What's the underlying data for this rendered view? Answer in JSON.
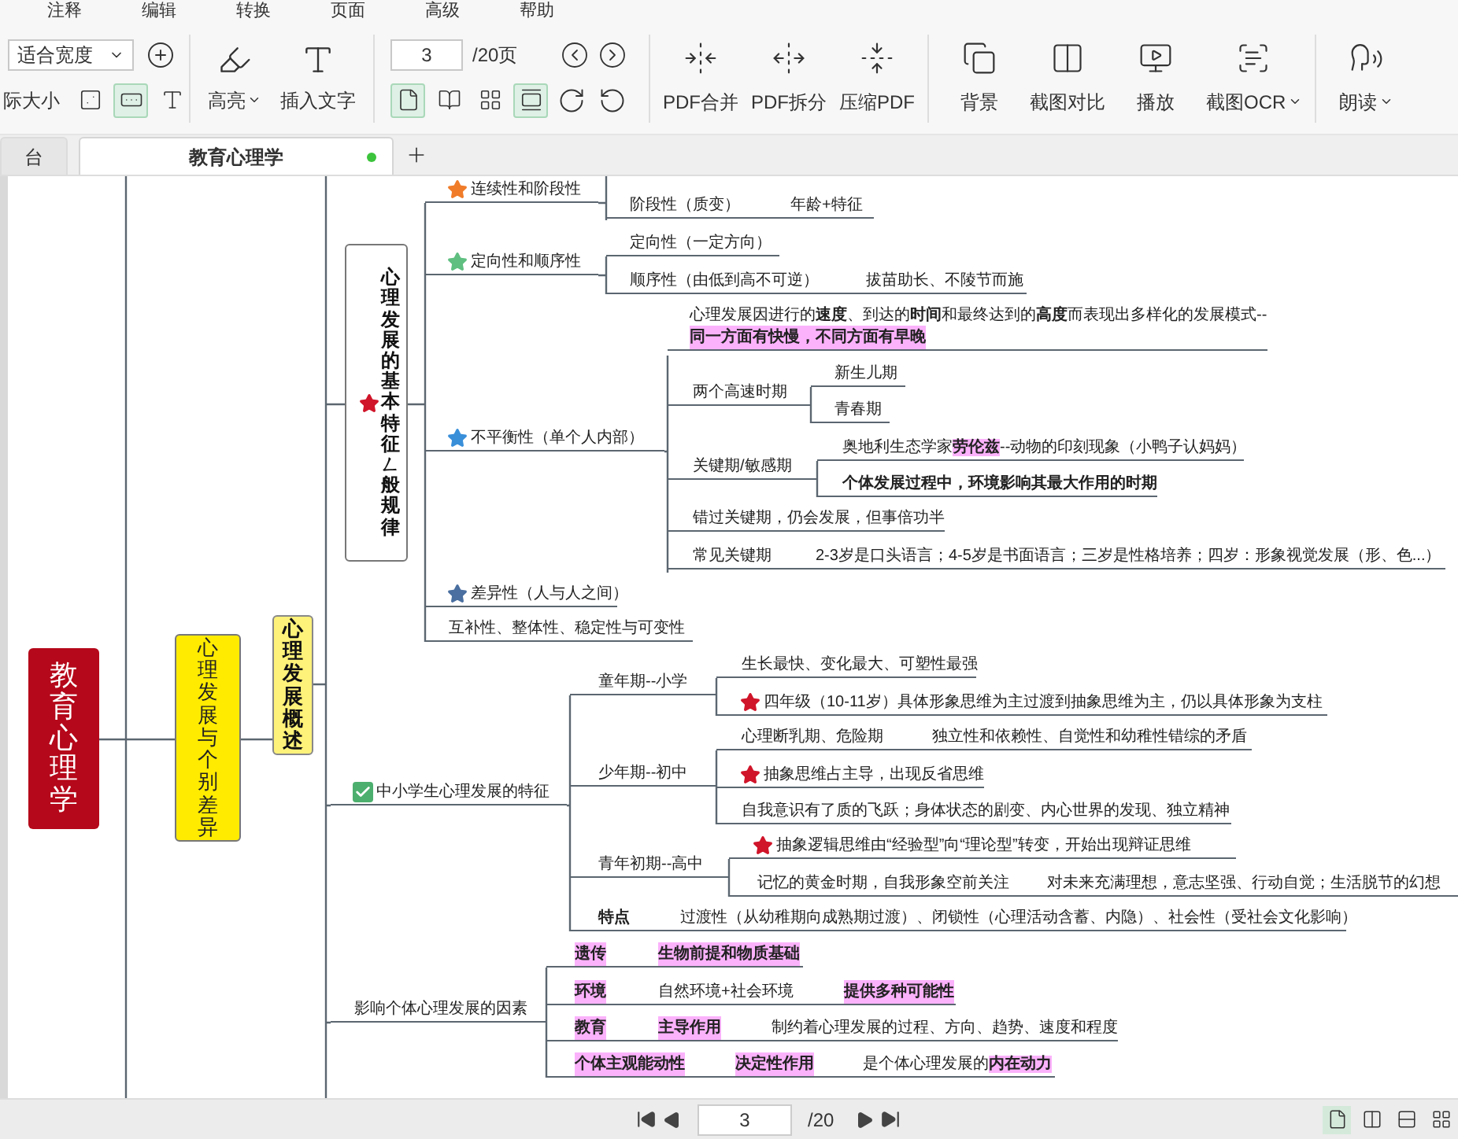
{
  "menu": [
    "注释",
    "编辑",
    "转换",
    "页面",
    "高级",
    "帮助"
  ],
  "toolbar": {
    "zoom": {
      "value": "适合宽度"
    },
    "actual_size": "际大小",
    "fit_modes": [
      {
        "kind": "page",
        "selected": false
      },
      {
        "kind": "width",
        "selected": true
      },
      {
        "kind": "text",
        "selected": false
      }
    ],
    "tools": [
      {
        "kind": "highlight",
        "label": "高亮",
        "dropdown": true
      },
      {
        "kind": "text",
        "label": "插入文字",
        "dropdown": false
      }
    ],
    "page": {
      "value": "3",
      "total": "/20页"
    },
    "view_modes": [
      {
        "kind": "single",
        "selected": true
      },
      {
        "kind": "double",
        "selected": false
      },
      {
        "kind": "grid",
        "selected": false
      },
      {
        "kind": "continuous",
        "selected": true
      }
    ],
    "actions": [
      {
        "kind": "merge",
        "label": "PDF合并",
        "dropdown": false
      },
      {
        "kind": "split",
        "label": "PDF拆分",
        "dropdown": false
      },
      {
        "kind": "compress",
        "label": "压缩PDF",
        "dropdown": false
      },
      {
        "kind": "background",
        "label": "背景",
        "dropdown": false
      },
      {
        "kind": "compare",
        "label": "截图对比",
        "dropdown": false
      },
      {
        "kind": "play",
        "label": "播放",
        "dropdown": false
      },
      {
        "kind": "ocr",
        "label": "截图OCR",
        "dropdown": true
      },
      {
        "kind": "read",
        "label": "朗读",
        "dropdown": true
      }
    ]
  },
  "tabs": [
    {
      "label": "台",
      "selected": false,
      "modified": false
    },
    {
      "label": "教育心理学",
      "selected": true,
      "modified": true
    }
  ],
  "mindmap": {
    "root": "教育心理学",
    "branch": "心理发展与个别差异",
    "subbranch": "心理发展概述",
    "feature_box": {
      "text": "心理发展的基本特征ㄥ般规律",
      "icon": {
        "kind": "star",
        "color": "#d0152a"
      }
    },
    "nodes": [
      {
        "icon": {
          "kind": "star",
          "color": "#f07c2a"
        },
        "segments": [
          {
            "text": "连续性和阶段性",
            "bold": false,
            "highlight": false
          }
        ]
      },
      {
        "segments": [
          {
            "text": "阶段性（质变）",
            "bold": false,
            "highlight": false
          },
          {
            "text": "年龄+特征",
            "bold": false,
            "highlight": false
          }
        ]
      },
      {
        "icon": {
          "kind": "star",
          "color": "#5fbf80"
        },
        "segments": [
          {
            "text": "定向性和顺序性",
            "bold": false,
            "highlight": false
          }
        ]
      },
      {
        "segments": [
          {
            "text": "定向性（一定方向）",
            "bold": false,
            "highlight": false
          }
        ]
      },
      {
        "segments": [
          {
            "text": "顺序性（由低到高不可逆）",
            "bold": false,
            "highlight": false
          },
          {
            "text": "拔苗助长、不陵节而施",
            "bold": false,
            "highlight": false
          }
        ]
      },
      {
        "segments": [
          {
            "text": "心理发展因进行的**速度**、到达的**时间**和最终达到的**高度**而表现出多样化的发展模式--",
            "bold": false,
            "highlight": false
          }
        ]
      },
      {
        "segments": [
          {
            "text": "同一方面有快慢，不同方面有早晚",
            "bold": true,
            "highlight": true
          }
        ]
      },
      {
        "icon": {
          "kind": "star",
          "color": "#3a8fd9"
        },
        "segments": [
          {
            "text": "不平衡性（单个人内部）",
            "bold": false,
            "highlight": false
          }
        ]
      },
      {
        "segments": [
          {
            "text": "两个高速时期",
            "bold": false,
            "highlight": false
          }
        ]
      },
      {
        "segments": [
          {
            "text": "新生儿期",
            "bold": false,
            "highlight": false
          }
        ]
      },
      {
        "segments": [
          {
            "text": "青春期",
            "bold": false,
            "highlight": false
          }
        ]
      },
      {
        "segments": [
          {
            "text": "关键期/敏感期",
            "bold": false,
            "highlight": false
          }
        ]
      },
      {
        "segments": [
          {
            "parts": [
              {
                "text": "奥地利生态学家",
                "bold": false,
                "highlight": false
              },
              {
                "text": "劳伦兹",
                "bold": true,
                "highlight": true
              },
              {
                "text": "--动物的印刻现象（小鸭子认妈妈）",
                "bold": false,
                "highlight": false
              }
            ]
          }
        ]
      },
      {
        "segments": [
          {
            "text": "个体发展过程中，环境影响其最大作用的时期",
            "bold": true,
            "highlight": false
          }
        ]
      },
      {
        "segments": [
          {
            "text": "错过关键期，仍会发展，但事倍功半",
            "bold": false,
            "highlight": false
          }
        ]
      },
      {
        "segments": [
          {
            "text": "常见关键期",
            "bold": false,
            "highlight": false
          },
          {
            "text": "2-3岁是口头语言；4-5岁是书面语言；三岁是性格培养；四岁：形象视觉发展（形、色...）",
            "bold": false,
            "highlight": false
          }
        ]
      },
      {
        "icon": {
          "kind": "star",
          "color": "#4a6fa0"
        },
        "segments": [
          {
            "text": "差异性（人与人之间）",
            "bold": false,
            "highlight": false
          }
        ]
      },
      {
        "segments": [
          {
            "text": "互补性、整体性、稳定性与可变性",
            "bold": false,
            "highlight": false
          }
        ]
      },
      {
        "icon": {
          "kind": "check",
          "color": "#4caf6e"
        },
        "segments": [
          {
            "text": "中小学生心理发展的特征",
            "bold": false,
            "highlight": false
          }
        ]
      },
      {
        "segments": [
          {
            "text": "童年期--小学",
            "bold": false,
            "highlight": false
          }
        ]
      },
      {
        "segments": [
          {
            "text": "生长最快、变化最大、可塑性最强",
            "bold": false,
            "highlight": false
          }
        ]
      },
      {
        "icon": {
          "kind": "star",
          "color": "#d0152a"
        },
        "segments": [
          {
            "text": "四年级（10-11岁）具体形象思维为主过渡到抽象思维为主，仍以具体形象为支柱",
            "bold": false,
            "highlight": false
          }
        ]
      },
      {
        "segments": [
          {
            "text": "少年期--初中",
            "bold": false,
            "highlight": false
          }
        ]
      },
      {
        "segments": [
          {
            "text": "心理断乳期、危险期",
            "bold": false,
            "highlight": false
          },
          {
            "text": "独立性和依赖性、自觉性和幼稚性错综的矛盾",
            "bold": false,
            "highlight": false
          }
        ]
      },
      {
        "icon": {
          "kind": "star",
          "color": "#d0152a"
        },
        "segments": [
          {
            "text": "抽象思维占主导，出现反省思维",
            "bold": false,
            "highlight": false
          }
        ]
      },
      {
        "segments": [
          {
            "text": "自我意识有了质的飞跃；身体状态的剧变、内心世界的发现、独立精神",
            "bold": false,
            "highlight": false
          }
        ]
      },
      {
        "segments": [
          {
            "text": "青年初期--高中",
            "bold": false,
            "highlight": false
          }
        ]
      },
      {
        "icon": {
          "kind": "star",
          "color": "#d0152a"
        },
        "segments": [
          {
            "text": "抽象逻辑思维由“经验型”向“理论型”转变，开始出现辩证思维",
            "bold": false,
            "highlight": false
          }
        ]
      },
      {
        "segments": [
          {
            "text": "记忆的黄金时期，自我形象空前关注",
            "bold": false,
            "highlight": false
          },
          {
            "text": "对未来充满理想，意志坚强、行动自觉；生活脱节的幻想",
            "bold": false,
            "highlight": false
          }
        ]
      },
      {
        "segments": [
          {
            "text": "特点",
            "bold": true,
            "highlight": false
          },
          {
            "text": "过渡性（从幼稚期向成熟期过渡）、闭锁性（心理活动含蓄、内隐）、社会性（受社会文化影响）",
            "bold": false,
            "highlight": false
          }
        ]
      },
      {
        "segments": [
          {
            "text": "影响个体心理发展的因素",
            "bold": false,
            "highlight": false
          }
        ]
      },
      {
        "segments": [
          {
            "text": "遗传",
            "bold": true,
            "highlight": true
          },
          {
            "text": "生物前提和物质基础",
            "bold": true,
            "highlight": true
          }
        ]
      },
      {
        "segments": [
          {
            "text": "环境",
            "bold": true,
            "highlight": true
          },
          {
            "text": "自然环境+社会环境",
            "bold": false,
            "highlight": false
          },
          {
            "text": "提供多种可能性",
            "bold": true,
            "highlight": true
          }
        ]
      },
      {
        "segments": [
          {
            "text": "教育",
            "bold": true,
            "highlight": true
          },
          {
            "text": "主导作用",
            "bold": true,
            "highlight": true
          },
          {
            "text": "制约着心理发展的过程、方向、趋势、速度和程度",
            "bold": false,
            "highlight": false
          }
        ]
      },
      {
        "segments": [
          {
            "text": "个体主观能动性",
            "bold": true,
            "highlight": true
          },
          {
            "text": "决定性作用",
            "bold": true,
            "highlight": true
          },
          {
            "parts": [
              {
                "text": "是个体心理发展的",
                "bold": false,
                "highlight": false
              },
              {
                "text": "内在动力",
                "bold": true,
                "highlight": true
              }
            ]
          }
        ]
      }
    ]
  },
  "pager": {
    "value": "3",
    "total": "/20"
  },
  "layouts": [
    {
      "kind": "single",
      "selected": true
    },
    {
      "kind": "double",
      "selected": false
    },
    {
      "kind": "continuous",
      "selected": false
    },
    {
      "kind": "grid",
      "selected": false
    }
  ]
}
